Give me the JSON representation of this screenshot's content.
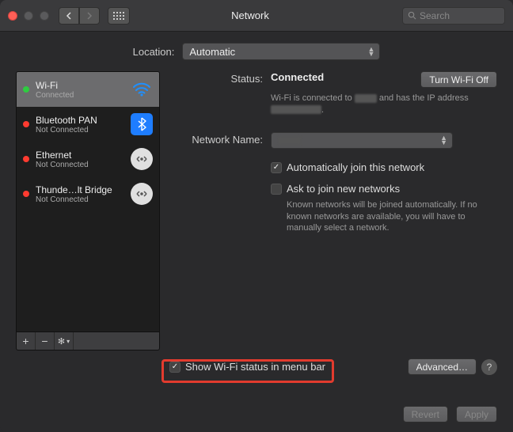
{
  "titlebar": {
    "title": "Network",
    "search_placeholder": "Search"
  },
  "location": {
    "label": "Location:",
    "value": "Automatic"
  },
  "sidebar": {
    "items": [
      {
        "name": "Wi-Fi",
        "status": "Connected",
        "light": "green",
        "icon": "wifi",
        "selected": true
      },
      {
        "name": "Bluetooth PAN",
        "status": "Not Connected",
        "light": "red",
        "icon": "bt",
        "selected": false
      },
      {
        "name": "Ethernet",
        "status": "Not Connected",
        "light": "red",
        "icon": "eth",
        "selected": false
      },
      {
        "name": "Thunde…lt Bridge",
        "status": "Not Connected",
        "light": "red",
        "icon": "eth",
        "selected": false
      }
    ]
  },
  "main": {
    "status_label": "Status:",
    "status_value": "Connected",
    "turn_off_label": "Turn Wi-Fi Off",
    "status_desc_prefix": "Wi-Fi is connected to ",
    "status_desc_mid": " and has the IP address ",
    "status_desc_suffix": ".",
    "network_name_label": "Network Name:",
    "network_name_value": "",
    "auto_join_label": "Automatically join this network",
    "auto_join_checked": true,
    "ask_join_label": "Ask to join new networks",
    "ask_join_checked": false,
    "ask_join_desc": "Known networks will be joined automatically. If no known networks are available, you will have to manually select a network.",
    "show_menubar_label": "Show Wi-Fi status in menu bar",
    "show_menubar_checked": true,
    "advanced_label": "Advanced…"
  },
  "footer": {
    "revert": "Revert",
    "apply": "Apply"
  }
}
